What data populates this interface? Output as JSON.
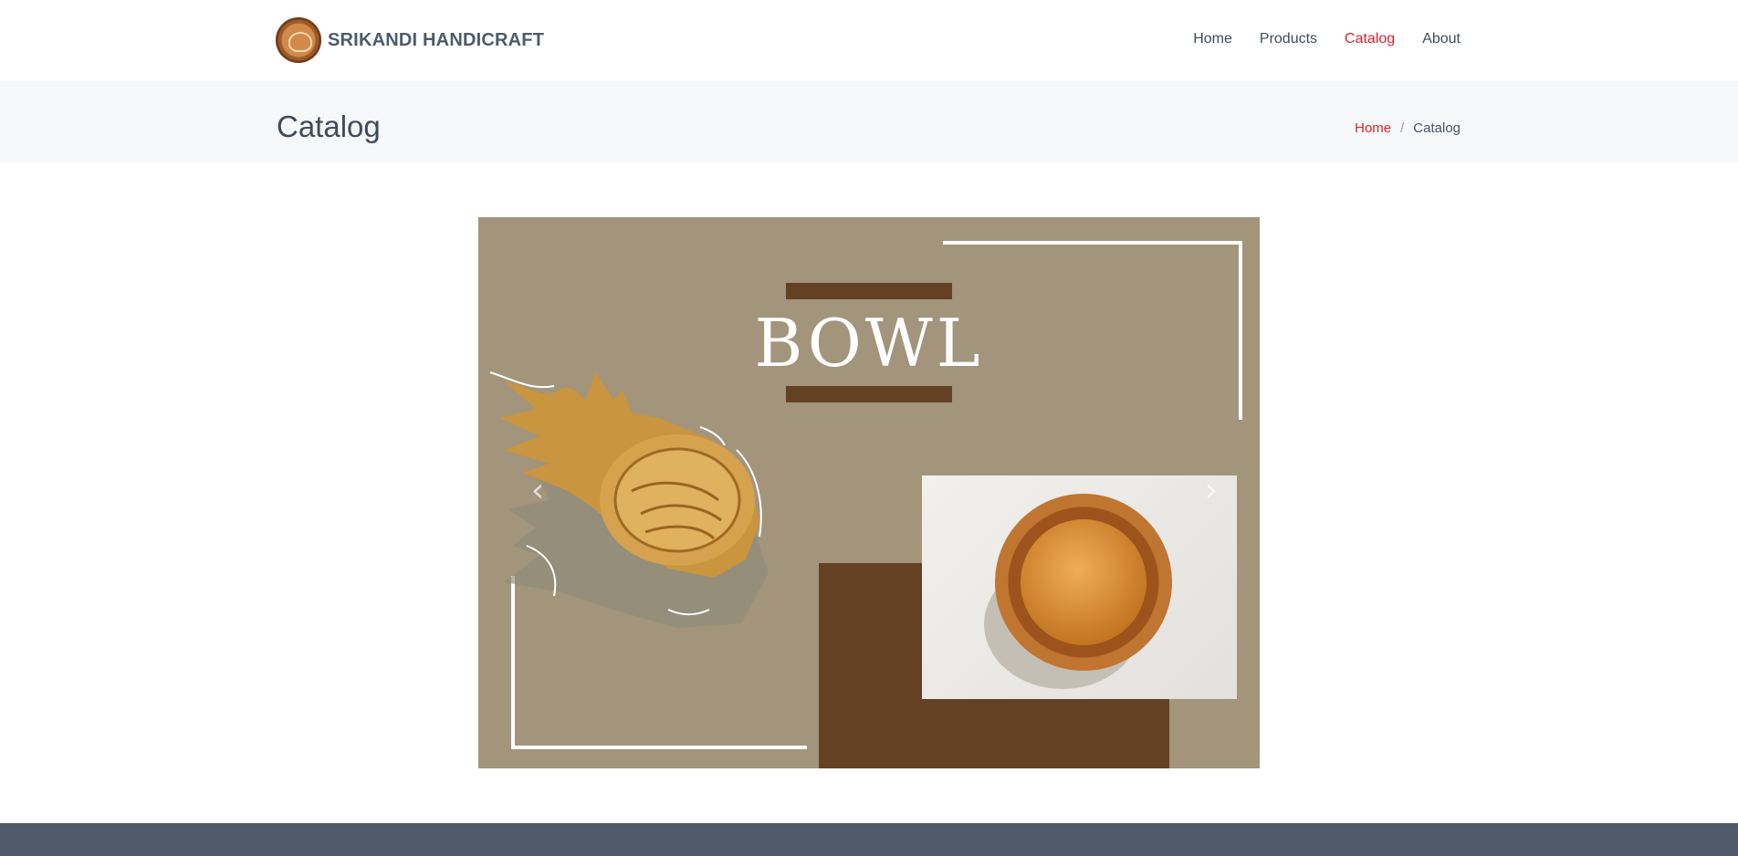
{
  "brand": {
    "name": "SRIKANDI HANDICRAFT",
    "logo_icon": "brand-logo-icon"
  },
  "nav": [
    {
      "label": "Home",
      "active": false
    },
    {
      "label": "Products",
      "active": false
    },
    {
      "label": "Catalog",
      "active": true
    },
    {
      "label": "About",
      "active": false
    }
  ],
  "page": {
    "title": "Catalog",
    "breadcrumb": {
      "home": "Home",
      "separator": "/",
      "current": "Catalog"
    }
  },
  "carousel": {
    "slide_title": "BOWL",
    "prev_icon": "chevron-left-icon",
    "next_icon": "chevron-right-icon",
    "prev_glyph": "‹",
    "next_glyph": "›"
  },
  "colors": {
    "accent": "#e21f2a",
    "text": "#3f4b59",
    "slide_bg": "#a3947c",
    "slide_dark": "#654124",
    "footer_bg": "#4f5b69"
  }
}
